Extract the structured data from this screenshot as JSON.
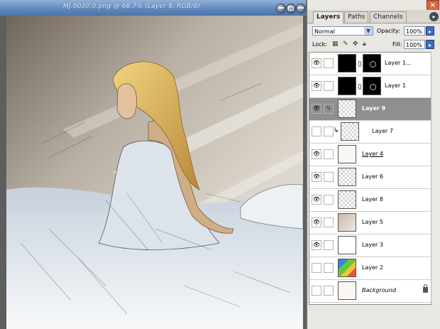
{
  "document": {
    "title": "MJ.0030.0.png @ 66.7% (Layer 9, RGB/8)"
  },
  "layers_panel": {
    "tabs": [
      "Layers",
      "Paths",
      "Channels"
    ],
    "blend_mode": "Normal",
    "opacity_label": "Opacity:",
    "opacity_value": "100%",
    "lock_label": "Lock:",
    "fill_label": "Fill:",
    "fill_value": "100%",
    "layers": [
      {
        "name": "Layer 1...",
        "visible": true,
        "thumb": "black",
        "mask": true,
        "selected": false
      },
      {
        "name": "Layer 1",
        "visible": true,
        "thumb": "black",
        "mask": true,
        "selected": false
      },
      {
        "name": "Layer 9",
        "visible": true,
        "thumb": "checker",
        "mask": false,
        "selected": true
      },
      {
        "name": "Layer 7",
        "visible": false,
        "thumb": "checker",
        "mask": false,
        "clipped": true
      },
      {
        "name": "Layer 4",
        "visible": true,
        "thumb": "sketch",
        "mask": false
      },
      {
        "name": "Layer 6",
        "visible": true,
        "thumb": "checker",
        "mask": false
      },
      {
        "name": "Layer 8",
        "visible": true,
        "thumb": "checker",
        "mask": false
      },
      {
        "name": "Layer 5",
        "visible": true,
        "thumb": "tan",
        "mask": false
      },
      {
        "name": "Layer 3",
        "visible": true,
        "thumb": "white",
        "mask": false
      },
      {
        "name": "Layer 2",
        "visible": false,
        "thumb": "colors",
        "mask": false
      },
      {
        "name": "Background",
        "visible": false,
        "thumb": "sketch",
        "mask": false,
        "locked": true
      }
    ]
  },
  "colors": {
    "titlebar": "#5f86bb",
    "selected_row": "#8f8f8f",
    "close_button": "#d4683f"
  }
}
